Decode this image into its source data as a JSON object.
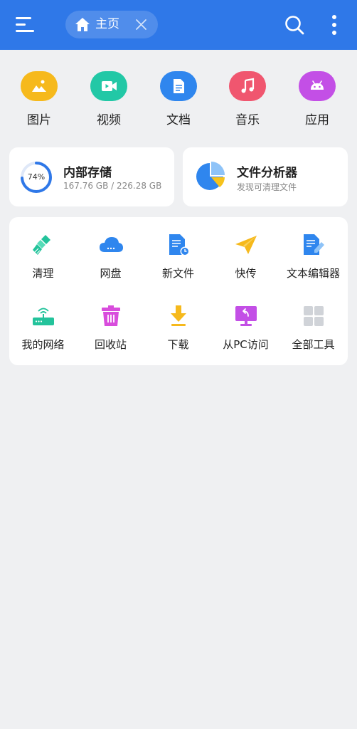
{
  "header": {
    "tab_label": "主页",
    "accent": "#2f78e8"
  },
  "categories": [
    {
      "label": "图片",
      "icon": "image-icon",
      "color": "#f6b91c"
    },
    {
      "label": "视频",
      "icon": "video-icon",
      "color": "#22c8a6"
    },
    {
      "label": "文档",
      "icon": "document-icon",
      "color": "#2f86ee"
    },
    {
      "label": "音乐",
      "icon": "music-icon",
      "color": "#f0566f"
    },
    {
      "label": "应用",
      "icon": "android-icon",
      "color": "#c34fe6"
    }
  ],
  "storage": {
    "percent_label": "74%",
    "percent": 0.74,
    "title": "内部存储",
    "usage": "167.76 GB / 226.28 GB"
  },
  "analyzer": {
    "title": "文件分析器",
    "subtitle": "发现可清理文件"
  },
  "tools": [
    {
      "label": "清理",
      "icon": "broom-icon"
    },
    {
      "label": "网盘",
      "icon": "cloud-drive-icon"
    },
    {
      "label": "新文件",
      "icon": "new-file-icon"
    },
    {
      "label": "快传",
      "icon": "paper-plane-icon"
    },
    {
      "label": "文本编辑器",
      "icon": "text-editor-icon"
    },
    {
      "label": "我的网络",
      "icon": "router-icon"
    },
    {
      "label": "回收站",
      "icon": "trash-icon"
    },
    {
      "label": "下载",
      "icon": "download-icon"
    },
    {
      "label": "从PC访问",
      "icon": "pc-access-icon"
    },
    {
      "label": "全部工具",
      "icon": "all-tools-icon"
    }
  ]
}
